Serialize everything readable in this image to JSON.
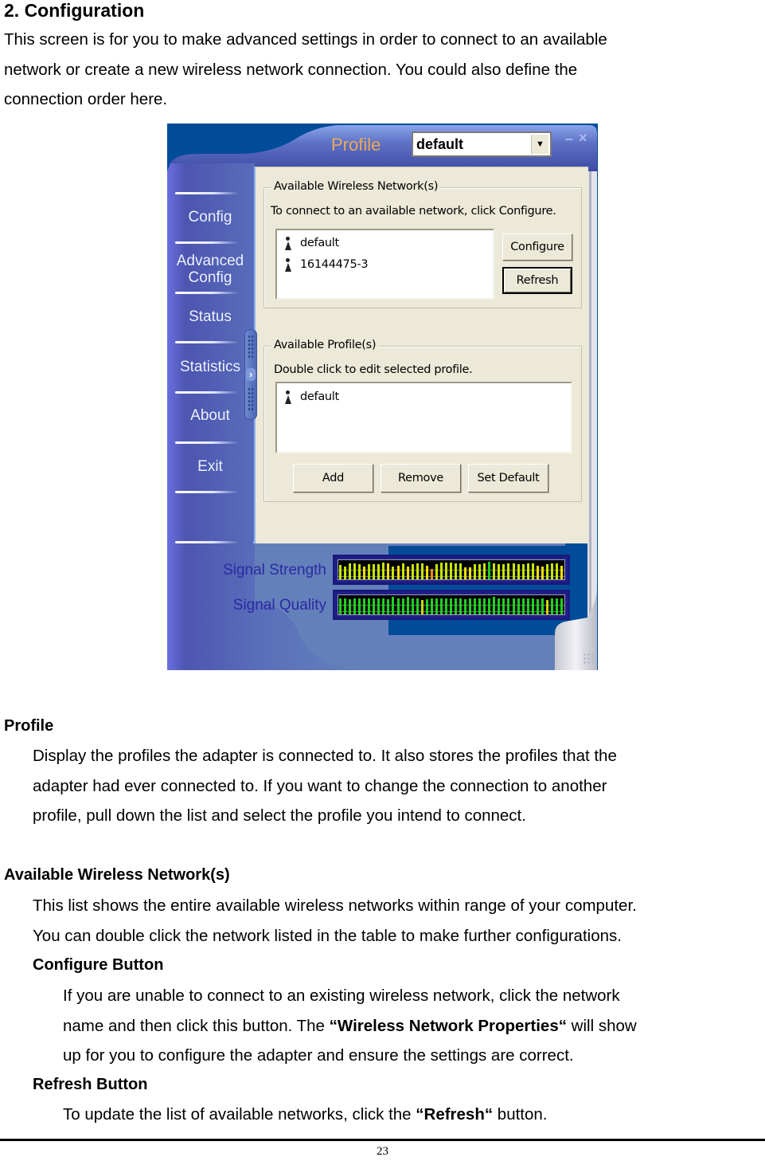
{
  "document": {
    "title": "2. Configuration",
    "intro_lines": [
      "This screen is for you to make advanced settings in order to connect to an available",
      "network or create a new wireless network connection. You could also define the",
      "connection order here."
    ],
    "page_number": "23"
  },
  "app": {
    "header": {
      "title": "Profile",
      "profile_select_value": "default",
      "dropdown_icon": "chevron-down-icon",
      "minimize_icon": "minimize-icon",
      "close_icon": "close-icon"
    },
    "sidebar": {
      "items": [
        {
          "label": "Config"
        },
        {
          "label": "Advanced"
        },
        {
          "label": "Config"
        },
        {
          "label": "Status"
        },
        {
          "label": "Statistics"
        },
        {
          "label": "About"
        },
        {
          "label": "Exit"
        }
      ],
      "advanced_config_label": "Advanced Config",
      "collapse_handle_glyph": "›"
    },
    "wireless_group": {
      "legend": "Available Wireless Network(s)",
      "hint": "To connect to an available network, click Configure.",
      "networks": [
        "default",
        "16144475-3"
      ],
      "configure_label": "Configure",
      "refresh_label": "Refresh"
    },
    "profiles_group": {
      "legend": "Available Profile(s)",
      "hint": "Double click to edit selected profile.",
      "profiles": [
        "default"
      ],
      "add_label": "Add",
      "remove_label": "Remove",
      "set_default_label": "Set Default"
    },
    "signal": {
      "strength_label": "Signal Strength",
      "quality_label": "Signal Quality",
      "strength_levels": [
        0.82,
        0.72,
        0.9,
        0.9,
        0.86,
        0.72,
        0.86,
        0.86,
        0.86,
        0.95,
        0.9,
        0.72,
        0.76,
        0.9,
        0.72,
        0.86,
        0.9,
        0.9,
        0.76,
        0.6,
        0.86,
        0.95,
        0.95,
        0.95,
        0.9,
        0.9,
        0.7,
        0.7,
        0.86,
        0.86,
        0.9,
        1.0,
        0.9,
        0.86,
        0.86,
        0.9,
        0.9,
        0.86,
        0.86,
        0.9,
        0.9,
        0.76,
        0.72,
        0.86,
        0.9,
        0.9,
        0.76
      ],
      "strength_colors": [
        "#c8e600",
        "#c8e600",
        "#c8e600",
        "#c8e600",
        "#c8e600",
        "#f0e000",
        "#c8e600",
        "#c8e600",
        "#c8e600",
        "#c8e600",
        "#f0e000",
        "#c8e600",
        "#f0e000",
        "#c8e600",
        "#f0e000",
        "#c8e600",
        "#c8e600",
        "#c8e600",
        "#f0e000",
        "#e89000",
        "#c8e600",
        "#c8e600",
        "#c8e600",
        "#c8e600",
        "#c8e600",
        "#c8e600",
        "#f0e000",
        "#f0e000",
        "#c8e600",
        "#c8e600",
        "#c8e600",
        "#20d020",
        "#c8e600",
        "#c8e600",
        "#c8e600",
        "#c8e600",
        "#c8e600",
        "#c8e600",
        "#c8e600",
        "#c8e600",
        "#c8e600",
        "#f0e000",
        "#f0e000",
        "#c8e600",
        "#c8e600",
        "#c8e600",
        "#f0e000"
      ],
      "quality_levels": [
        0.92,
        0.9,
        0.88,
        0.92,
        0.92,
        0.92,
        0.92,
        0.92,
        0.92,
        0.92,
        0.88,
        0.98,
        0.92,
        0.92,
        0.98,
        0.92,
        0.92,
        0.82,
        0.88,
        0.92,
        0.92,
        0.92,
        0.92,
        0.92,
        0.92,
        0.92,
        0.88,
        0.92,
        0.92,
        0.92,
        0.92,
        0.92,
        0.98,
        0.92,
        0.92,
        0.92,
        0.92,
        0.92,
        0.92,
        0.92,
        0.92,
        0.88,
        0.92,
        0.82,
        0.92,
        0.92,
        0.92
      ],
      "quality_colors": [
        "#20d020",
        "#20d020",
        "#20d020",
        "#20d020",
        "#20d020",
        "#20d020",
        "#20d020",
        "#20d020",
        "#20d020",
        "#20d020",
        "#20d020",
        "#20d020",
        "#20d020",
        "#20d020",
        "#20d020",
        "#20d020",
        "#20d020",
        "#c8d800",
        "#20d020",
        "#20d020",
        "#20d020",
        "#20d020",
        "#20d020",
        "#20d020",
        "#20d020",
        "#20d020",
        "#20d020",
        "#20d020",
        "#20d020",
        "#20d020",
        "#20d020",
        "#20d020",
        "#20d020",
        "#20d020",
        "#20d020",
        "#20d020",
        "#20d020",
        "#20d020",
        "#20d020",
        "#20d020",
        "#20d020",
        "#20d020",
        "#20d020",
        "#c8d800",
        "#20d020",
        "#20d020",
        "#20d020"
      ]
    },
    "resize_grip_icon": "resize-grip-icon"
  },
  "sections": {
    "profile": {
      "heading": "Profile",
      "lines": [
        "Display the profiles the adapter is connected to. It also stores the profiles that the",
        "adapter had ever connected to. If you want to change the connection to another",
        "profile, pull down the list and select the profile you intend to connect."
      ]
    },
    "wireless": {
      "heading": "Available Wireless Network(s)",
      "lines": [
        "This list shows the entire available wireless networks within range of your computer.",
        "You can double click the network listed in the table to make further configurations."
      ],
      "configure": {
        "heading": "Configure Button",
        "line1": "If you are unable to connect to an existing wireless network, click the network",
        "line2_pre": "name and then click this button. The ",
        "line2_bold": "“Wireless Network Properties“",
        "line2_post": " will show",
        "line3": "up for you to configure the adapter and ensure the settings are correct."
      },
      "refresh": {
        "heading": "Refresh Button",
        "line_pre": "To update the list of available networks, click the ",
        "line_bold": "“Refresh“",
        "line_post": " button."
      }
    }
  }
}
